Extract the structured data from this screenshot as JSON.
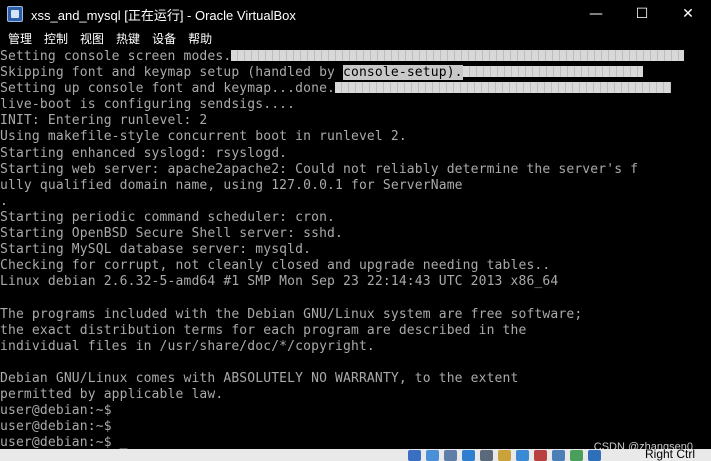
{
  "window": {
    "title": "xss_and_mysql [正在运行] - Oracle VirtualBox",
    "controls": {
      "minimize": "—",
      "maximize": "☐",
      "close": "✕"
    }
  },
  "menu": {
    "items": [
      {
        "label": "管理"
      },
      {
        "label": "控制"
      },
      {
        "label": "视图"
      },
      {
        "label": "热键"
      },
      {
        "label": "设备"
      },
      {
        "label": "帮助"
      }
    ]
  },
  "console": {
    "line_setting_console": "Setting console screen modes.",
    "line_skipping_pre": "Skipping font and keymap setup (handled by ",
    "line_skipping_highlight": "console-setup).",
    "line_setting_up": "Setting up console font and keymap...done.",
    "lines": [
      "live-boot is configuring sendsigs....",
      "INIT: Entering runlevel: 2",
      "Using makefile-style concurrent boot in runlevel 2.",
      "Starting enhanced syslogd: rsyslogd.",
      "Starting web server: apache2apache2: Could not reliably determine the server's f",
      "ully qualified domain name, using 127.0.0.1 for ServerName",
      ".",
      "Starting periodic command scheduler: cron.",
      "Starting OpenBSD Secure Shell server: sshd.",
      "Starting MySQL database server: mysqld.",
      "Checking for corrupt, not cleanly closed and upgrade needing tables..",
      "Linux debian 2.6.32-5-amd64 #1 SMP Mon Sep 23 22:14:43 UTC 2013 x86_64",
      "",
      "The programs included with the Debian GNU/Linux system are free software;",
      "the exact distribution terms for each program are described in the",
      "individual files in /usr/share/doc/*/copyright.",
      "",
      "Debian GNU/Linux comes with ABSOLUTELY NO WARRANTY, to the extent",
      "permitted by applicable law.",
      "user@debian:~$",
      "user@debian:~$"
    ],
    "prompt": "user@debian:~$ ",
    "cursor": "_"
  },
  "status": {
    "host_key": "Right Ctrl",
    "icons": [
      "hard-disk-icon",
      "optical-drive-icon",
      "audio-icon",
      "network-icon",
      "usb-icon",
      "shared-folder-icon",
      "display-icon",
      "recording-icon",
      "cpu-icon",
      "mouse-integration-icon",
      "keyboard-icon"
    ],
    "icon_colors": [
      "#3a6fc4",
      "#4a8fd8",
      "#5f7fa8",
      "#2f7fd0",
      "#5a6a7a",
      "#c9a23a",
      "#3b8ad6",
      "#b84040",
      "#4a7fb8",
      "#4aa05a",
      "#2f6fba"
    ]
  },
  "watermark": "CSDN @zhangsen0"
}
